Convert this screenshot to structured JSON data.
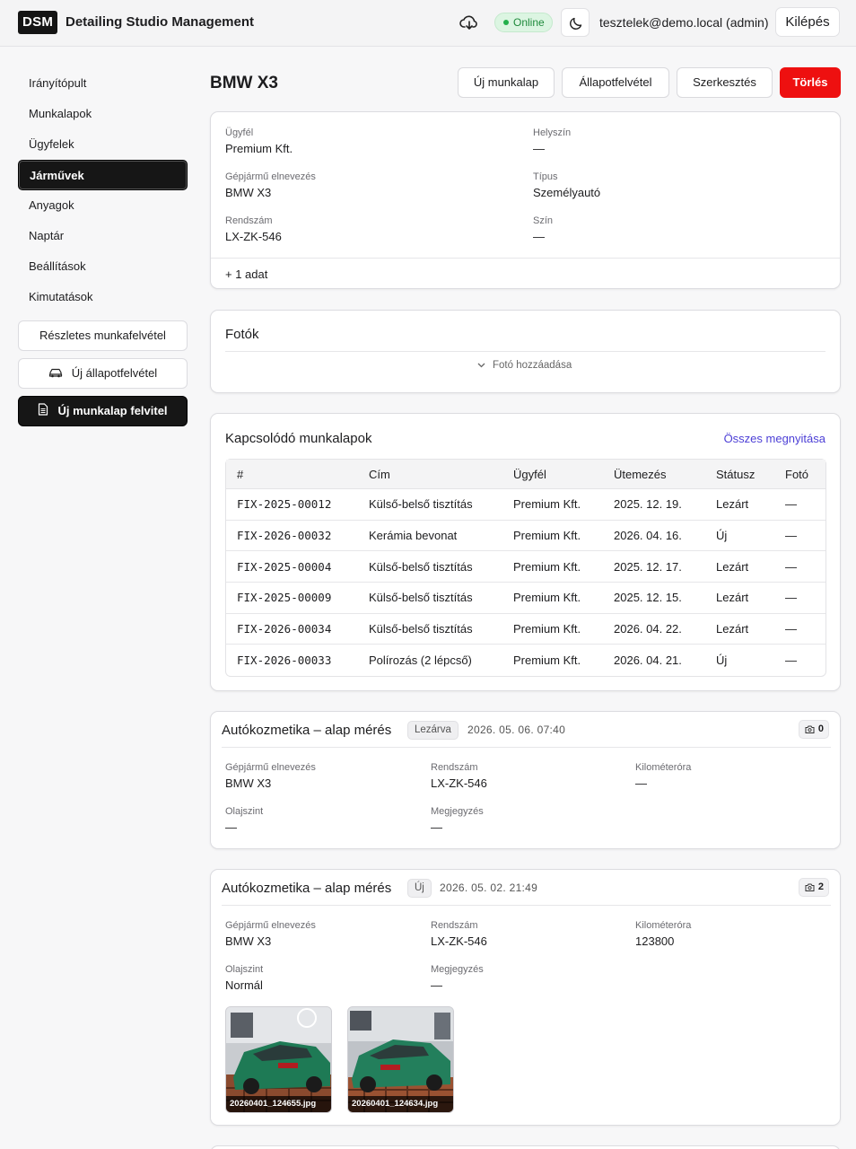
{
  "app": {
    "logo": "DSM",
    "title": "Detailing Studio Management",
    "status": "Online",
    "user": "tesztelek@demo.local (admin)",
    "logout": "Kilépés"
  },
  "sidebar": {
    "items": [
      {
        "label": "Irányítópult"
      },
      {
        "label": "Munkalapok"
      },
      {
        "label": "Ügyfelek"
      },
      {
        "label": "Járművek"
      },
      {
        "label": "Anyagok"
      },
      {
        "label": "Naptár"
      },
      {
        "label": "Beállítások"
      },
      {
        "label": "Kimutatások"
      }
    ],
    "active": "Járművek",
    "buttons": {
      "detailed": "Részletes munkafelvétel",
      "new_condition": "Új állapotfelvétel",
      "new_worksheet": "Új munkalap felvitel"
    }
  },
  "page": {
    "title": "BMW X3",
    "actions": {
      "new_worksheet": "Új munkalap",
      "condition": "Állapotfelvétel",
      "edit": "Szerkesztés",
      "delete": "Törlés"
    }
  },
  "vehicle": {
    "client_label": "Ügyfél",
    "client": "Premium Kft.",
    "location_label": "Helyszín",
    "location": "—",
    "name_label": "Gépjármű elnevezés",
    "name": "BMW X3",
    "type_label": "Típus",
    "type": "Személyautó",
    "plate_label": "Rendszám",
    "plate": "LX-ZK-546",
    "color_label": "Szín",
    "color": "—",
    "more": "+ 1 adat"
  },
  "photos": {
    "title": "Fotók",
    "add": "Fotó hozzáadása"
  },
  "related": {
    "title": "Kapcsolódó munkalapok",
    "open_all": "Összes megnyitása",
    "columns": [
      "#",
      "Cím",
      "Ügyfél",
      "Ütemezés",
      "Státusz",
      "Fotó"
    ],
    "rows": [
      [
        "FIX-2025-00012",
        "Külső-belső tisztítás",
        "Premium Kft.",
        "2025. 12. 19.",
        "Lezárt",
        "—"
      ],
      [
        "FIX-2026-00032",
        "Kerámia bevonat",
        "Premium Kft.",
        "2026. 04. 16.",
        "Új",
        "—"
      ],
      [
        "FIX-2025-00004",
        "Külső-belső tisztítás",
        "Premium Kft.",
        "2025. 12. 17.",
        "Lezárt",
        "—"
      ],
      [
        "FIX-2025-00009",
        "Külső-belső tisztítás",
        "Premium Kft.",
        "2025. 12. 15.",
        "Lezárt",
        "—"
      ],
      [
        "FIX-2026-00034",
        "Külső-belső tisztítás",
        "Premium Kft.",
        "2026. 04. 22.",
        "Lezárt",
        "—"
      ],
      [
        "FIX-2026-00033",
        "Polírozás (2 lépcső)",
        "Premium Kft.",
        "2026. 04. 21.",
        "Új",
        "—"
      ]
    ]
  },
  "inspections": [
    {
      "title": "Autókozmetika – alap mérés",
      "status": "Lezárva",
      "datetime": "2026. 05. 06. 07:40",
      "photo_count": "0",
      "name_label": "Gépjármű elnevezés",
      "name": "BMW X3",
      "plate_label": "Rendszám",
      "plate": "LX-ZK-546",
      "km_label": "Kilométeróra",
      "km": "—",
      "oil_label": "Olajszint",
      "oil": "—",
      "note_label": "Megjegyzés",
      "note": "—"
    },
    {
      "title": "Autókozmetika – alap mérés",
      "status": "Új",
      "datetime": "2026. 05. 02. 21:49",
      "photo_count": "2",
      "name_label": "Gépjármű elnevezés",
      "name": "BMW X3",
      "plate_label": "Rendszám",
      "plate": "LX-ZK-546",
      "km_label": "Kilométeróra",
      "km": "123800",
      "oil_label": "Olajszint",
      "oil": "Normál",
      "note_label": "Megjegyzés",
      "note": "—",
      "photos": [
        "20260401_124655.jpg",
        "20260401_124634.jpg"
      ]
    }
  ],
  "colors": {
    "accent_dark": "#161616",
    "danger": "#ee1010",
    "online_green": "#22b04b",
    "link": "#4c3fd6",
    "car_green": "#1e7a55"
  }
}
